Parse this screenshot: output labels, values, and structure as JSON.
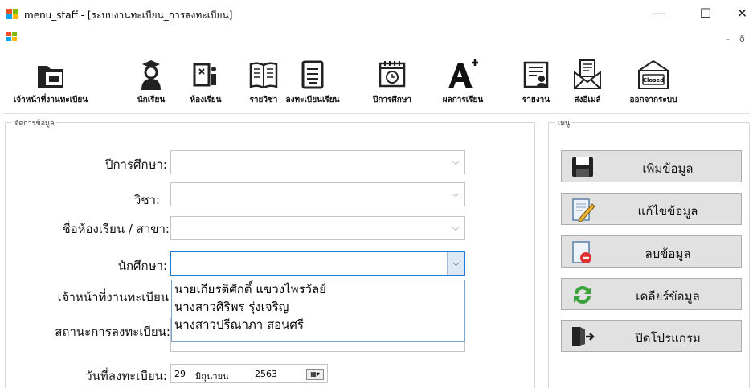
{
  "window": {
    "title": "menu_staff - [ระบบงานทะเบียน_การลงทะเบียน]",
    "minimize": "—",
    "maximize": "☐",
    "close": "✕",
    "mdi_minimize": "-",
    "mdi_restore": "ð"
  },
  "toolbar": {
    "items": [
      {
        "label": "เจ้าหน้าที่งานทะเบียน",
        "icon": "folder-icon"
      },
      {
        "label": "นักเรียน",
        "icon": "graduate-icon"
      },
      {
        "label": "ห้องเรียน",
        "icon": "classroom-icon"
      },
      {
        "label": "รายวิชา",
        "icon": "book-icon"
      },
      {
        "label": "ลงทะเบียนเรียน",
        "icon": "register-list-icon"
      },
      {
        "label": "ปีการศึกษา",
        "icon": "calendar-clock-icon"
      },
      {
        "label": "ผลการเรียน",
        "icon": "grade-a-plus-icon"
      },
      {
        "label": "รายงาน",
        "icon": "report-icon"
      },
      {
        "label": "ส่งอีเมล์",
        "icon": "email-icon"
      },
      {
        "label": "ออกจากระบบ",
        "icon": "closed-sign-icon"
      }
    ],
    "closed_sign_text": "Closed"
  },
  "manage_group": {
    "title": "จัดการข้อมูล",
    "fields": {
      "academic_year": {
        "label": "ปีการศึกษา:",
        "value": ""
      },
      "subject": {
        "label": "วิชา:",
        "value": ""
      },
      "classroom": {
        "label": "ชื่อห้องเรียน / สาขา:",
        "value": ""
      },
      "student": {
        "label": "นักศึกษา:",
        "value": ""
      },
      "staff": {
        "label": "เจ้าหน้าที่งานทะเบียน"
      },
      "status": {
        "label": "สถานะการลงทะเบียน:"
      },
      "reg_date": {
        "label": "วันที่ลงทะเบียน:",
        "day": "29",
        "month": "มิถุนายน",
        "year": "2563"
      }
    },
    "dropdown_options": [
      "นายเกียรติศักดิ์  แขวงไพรวัลย์",
      "นางสาวศิริพร  รุ่งเจริญ",
      "นางสาวปรีณาภา  สอนศรี"
    ]
  },
  "menu_group": {
    "title": "เมนู",
    "buttons": {
      "add": "เพิ่มข้อมูล",
      "edit": "แก้ไขข้อมูล",
      "delete": "ลบข้อมูล",
      "clear": "เคลียร์ข้อมูล",
      "close": "ปิดโปรแกรม"
    }
  }
}
